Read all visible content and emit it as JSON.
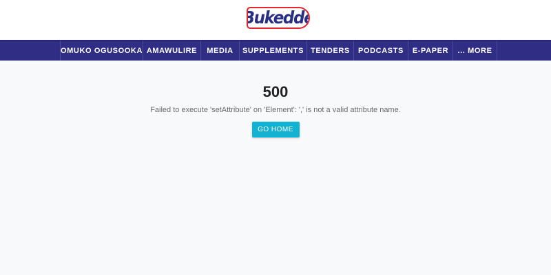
{
  "header": {
    "logo_text": "Bukedde",
    "logo_colors": {
      "text": "#2a2f86",
      "border": "#e3262b"
    }
  },
  "nav": {
    "background": "#2f2d84",
    "items": [
      {
        "label": "OMUKO OGUSOOKA"
      },
      {
        "label": "AMAWULIRE"
      },
      {
        "label": "MEDIA"
      },
      {
        "label": "SUPPLEMENTS"
      },
      {
        "label": "TENDERS"
      },
      {
        "label": "PODCASTS"
      },
      {
        "label": "E-PAPER"
      },
      {
        "label": "... MORE"
      }
    ]
  },
  "error": {
    "code": "500",
    "message": "Failed to execute 'setAttribute' on 'Element': ',' is not a valid attribute name.",
    "button_label": "GO HOME",
    "button_color": "#14b2d2"
  }
}
